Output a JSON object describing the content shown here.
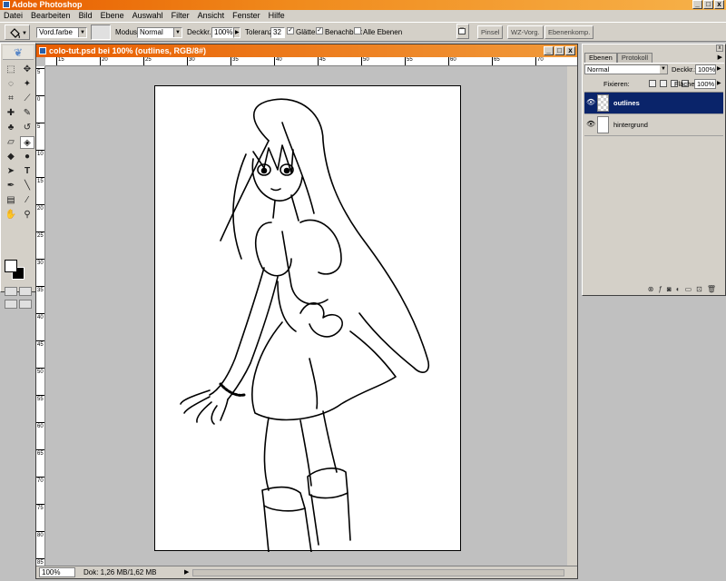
{
  "app": {
    "title": "Adobe Photoshop"
  },
  "window_controls": {
    "minimize": "_",
    "maximize": "□",
    "close": "x"
  },
  "menu": [
    "Datei",
    "Bearbeiten",
    "Bild",
    "Ebene",
    "Auswahl",
    "Filter",
    "Ansicht",
    "Fenster",
    "Hilfe"
  ],
  "options": {
    "fill_source": "Vord.farbe",
    "mode_label": "Modus:",
    "mode_value": "Normal",
    "opacity_label": "Deckkr.:",
    "opacity_value": "100%",
    "tolerance_label": "Toleranz:",
    "tolerance_value": "32",
    "antialias_label": "Glätten",
    "contiguous_label": "Benachbart",
    "all_layers_label": "Alle Ebenen",
    "antialias_checked": true,
    "contiguous_checked": true,
    "all_layers_checked": false
  },
  "palette_well": {
    "tabs": [
      "Pinsel",
      "WZ-Vorg.",
      "Ebenenkomp."
    ]
  },
  "document": {
    "title": "colo-tut.psd bei 100% (outlines, RGB/8#)",
    "ruler_h": [
      "15",
      "20",
      "25",
      "30",
      "35",
      "40",
      "45",
      "50",
      "55",
      "60",
      "65",
      "70"
    ],
    "ruler_v": [
      "5",
      "0",
      "5",
      "10",
      "15",
      "20",
      "25",
      "30",
      "35",
      "40",
      "45",
      "50",
      "55",
      "60",
      "65",
      "70",
      "75",
      "80",
      "85"
    ],
    "zoom": "100%",
    "doc_size": "Dok: 1,26 MB/1,62 MB"
  },
  "layers_palette": {
    "tabs": [
      "Ebenen",
      "Protokoll"
    ],
    "blend_mode": "Normal",
    "opacity_label": "Deckkr.:",
    "opacity_value": "100%",
    "lock_label": "Fixieren:",
    "fill_label": "Fläche:",
    "fill_value": "100%",
    "layers": [
      {
        "name": "outlines",
        "selected": true
      },
      {
        "name": "hintergrund",
        "selected": false
      }
    ]
  }
}
